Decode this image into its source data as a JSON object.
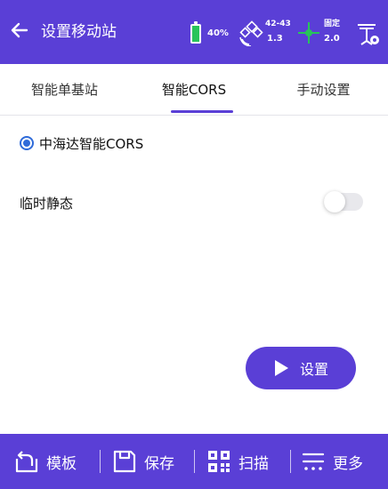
{
  "header": {
    "title": "设置移动站",
    "back_icon": "arrow-left-icon",
    "battery": "40%",
    "satellites": {
      "count": "42-43",
      "diff": "1.3"
    },
    "fix": {
      "status": "固定",
      "age": "2.0"
    }
  },
  "tabs": [
    {
      "label": "智能单基站"
    },
    {
      "label": "智能CORS",
      "selected": true
    },
    {
      "label": "手动设置"
    }
  ],
  "options": {
    "cors_label": "中海达智能CORS",
    "temp_static_label": "临时静态",
    "temp_static_on": false
  },
  "actions": {
    "set_label": "设置"
  },
  "bottom_bar": [
    {
      "label": "模板",
      "icon": "template-icon"
    },
    {
      "label": "保存",
      "icon": "save-icon"
    },
    {
      "label": "扫描",
      "icon": "qr-scan-icon"
    },
    {
      "label": "更多",
      "icon": "more-menu-icon"
    }
  ],
  "colors": {
    "primary": "#5a3fd6",
    "radio": "#2f6bd9",
    "battery": "#28c45a",
    "fix": "#28c45a"
  }
}
